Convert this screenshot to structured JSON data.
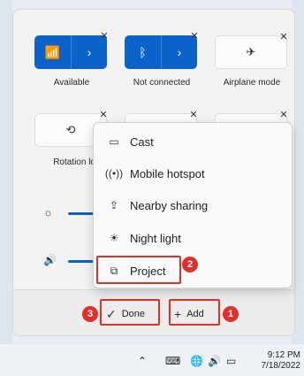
{
  "quick_settings": {
    "tiles": [
      {
        "label": "Available",
        "icon": "wifi-icon",
        "chevron": "›",
        "glyph": "📶"
      },
      {
        "label": "Not connected",
        "icon": "bluetooth-icon",
        "chevron": "›",
        "glyph": "ᛒ"
      },
      {
        "label": "Airplane mode",
        "icon": "airplane-icon",
        "glyph": "✈"
      },
      {
        "label": "Rotation loc",
        "icon": "rotation-lock-icon",
        "glyph": "⟲"
      }
    ],
    "pin_glyph": "✕"
  },
  "sliders": {
    "brightness_icon": "☼",
    "volume_icon": "🔊"
  },
  "menu": {
    "items": [
      {
        "label": "Cast",
        "icon": "cast-icon",
        "glyph": "▭"
      },
      {
        "label": "Mobile hotspot",
        "icon": "hotspot-icon",
        "glyph": "((•))"
      },
      {
        "label": "Nearby sharing",
        "icon": "nearby-sharing-icon",
        "glyph": "⇪"
      },
      {
        "label": "Night light",
        "icon": "night-light-icon",
        "glyph": "☀"
      },
      {
        "label": "Project",
        "icon": "project-icon",
        "glyph": "⧉"
      }
    ]
  },
  "footer": {
    "done_label": "Done",
    "done_glyph": "✓",
    "add_label": "Add",
    "add_glyph": "+"
  },
  "annotations": {
    "badge_1": "1",
    "badge_2": "2",
    "badge_3": "3",
    "color": "#e0302a"
  },
  "taskbar": {
    "chevron_glyph": "⌃",
    "keyboard_glyph": "⌨",
    "globe_glyph": "🌐",
    "volume_glyph": "🔊",
    "battery_glyph": "▭",
    "time": "9:12 PM",
    "date": "7/18/2022"
  }
}
